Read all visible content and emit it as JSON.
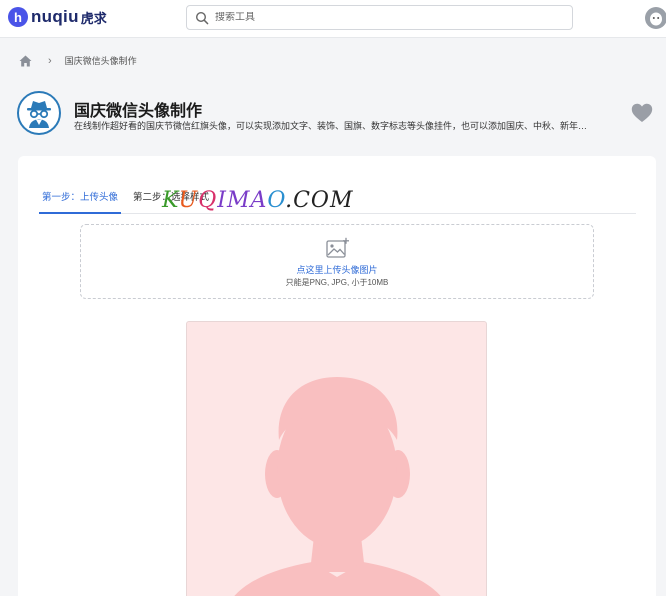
{
  "header": {
    "logo_mark": "h",
    "logo_word": "nuqiu",
    "logo_cn": "虎求",
    "search_placeholder": "搜索工具",
    "search_value": ""
  },
  "breadcrumb": {
    "current": "国庆微信头像制作"
  },
  "tool": {
    "title": "国庆微信头像制作",
    "description": "在线制作超好看的国庆节微信红旗头像，可以实现添加文字、装饰、国旗、数字标志等头像挂件，也可以添加国庆、中秋、新年…"
  },
  "tabs": [
    {
      "label": "第一步：上传头像",
      "active": true
    },
    {
      "label": "第二步：选择样式",
      "active": false
    }
  ],
  "watermark": [
    "K",
    "U",
    "Q",
    "IMA",
    "O",
    ".COM"
  ],
  "upload": {
    "link_text": "点这里上传头像图片",
    "hint": "只能是PNG, JPG, 小于10MB"
  },
  "colors": {
    "accent": "#2f6bd7",
    "preview_bg": "#fde6e6",
    "silhouette": "#f9bfc0",
    "brand": "#4a54e8"
  }
}
